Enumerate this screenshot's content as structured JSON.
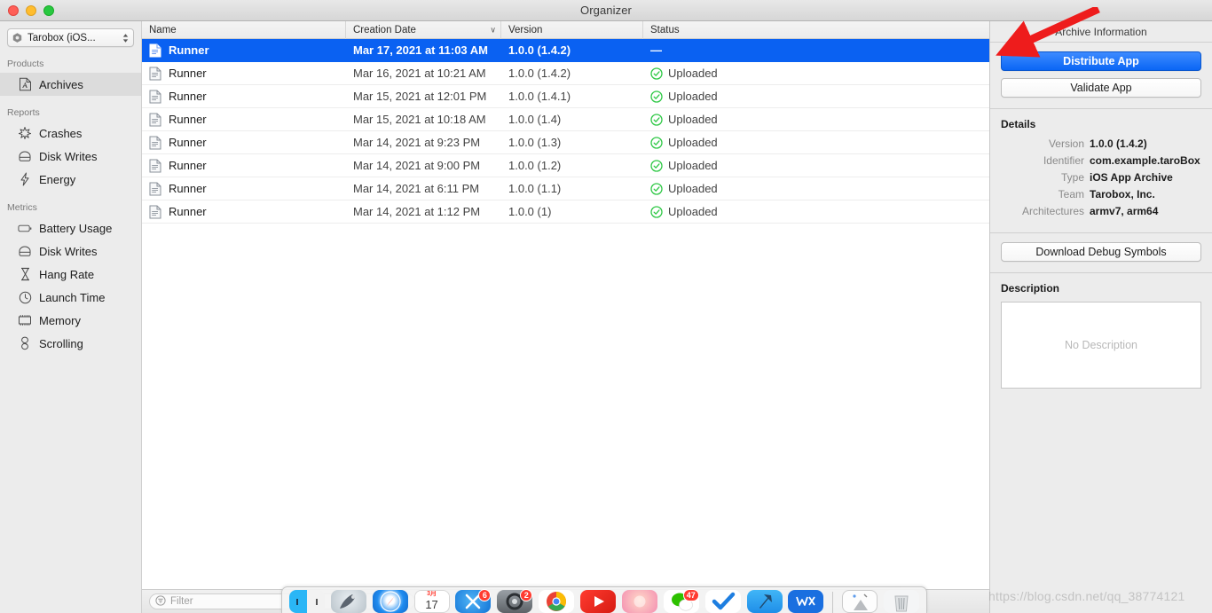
{
  "window": {
    "title": "Organizer",
    "traffic_lights": [
      "close-button",
      "minimize-button",
      "zoom-button"
    ]
  },
  "sidebar": {
    "scheme": {
      "label": "Tarobox (iOS...",
      "icon": "project-icon"
    },
    "groups": [
      {
        "title": "Products",
        "items": [
          {
            "label": "Archives",
            "icon": "archive-icon",
            "selected": true
          }
        ]
      },
      {
        "title": "Reports",
        "items": [
          {
            "label": "Crashes",
            "icon": "crashes-icon",
            "selected": false
          },
          {
            "label": "Disk Writes",
            "icon": "disk-writes-icon",
            "selected": false
          },
          {
            "label": "Energy",
            "icon": "energy-icon",
            "selected": false
          }
        ]
      },
      {
        "title": "Metrics",
        "items": [
          {
            "label": "Battery Usage",
            "icon": "battery-icon",
            "selected": false
          },
          {
            "label": "Disk Writes",
            "icon": "disk-writes-icon",
            "selected": false
          },
          {
            "label": "Hang Rate",
            "icon": "hourglass-icon",
            "selected": false
          },
          {
            "label": "Launch Time",
            "icon": "clock-icon",
            "selected": false
          },
          {
            "label": "Memory",
            "icon": "memory-icon",
            "selected": false
          },
          {
            "label": "Scrolling",
            "icon": "scrolling-icon",
            "selected": false
          }
        ]
      }
    ]
  },
  "table": {
    "columns": [
      {
        "label": "Name",
        "sorted": false
      },
      {
        "label": "Creation Date",
        "sorted": true,
        "sort_indicator": "∨"
      },
      {
        "label": "Version",
        "sorted": false
      },
      {
        "label": "Status",
        "sorted": false
      }
    ],
    "rows": [
      {
        "name": "Runner",
        "date": "Mar 17, 2021 at 11:03 AM",
        "version": "1.0.0 (1.4.2)",
        "status": "—",
        "status_icon": "none",
        "selected": true
      },
      {
        "name": "Runner",
        "date": "Mar 16, 2021 at 10:21 AM",
        "version": "1.0.0 (1.4.2)",
        "status": "Uploaded",
        "status_icon": "check-circle-icon",
        "selected": false
      },
      {
        "name": "Runner",
        "date": "Mar 15, 2021 at 12:01 PM",
        "version": "1.0.0 (1.4.1)",
        "status": "Uploaded",
        "status_icon": "check-circle-icon",
        "selected": false
      },
      {
        "name": "Runner",
        "date": "Mar 15, 2021 at 10:18 AM",
        "version": "1.0.0 (1.4)",
        "status": "Uploaded",
        "status_icon": "check-circle-icon",
        "selected": false
      },
      {
        "name": "Runner",
        "date": "Mar 14, 2021 at 9:23 PM",
        "version": "1.0.0 (1.3)",
        "status": "Uploaded",
        "status_icon": "check-circle-icon",
        "selected": false
      },
      {
        "name": "Runner",
        "date": "Mar 14, 2021 at 9:00 PM",
        "version": "1.0.0 (1.2)",
        "status": "Uploaded",
        "status_icon": "check-circle-icon",
        "selected": false
      },
      {
        "name": "Runner",
        "date": "Mar 14, 2021 at 6:11 PM",
        "version": "1.0.0 (1.1)",
        "status": "Uploaded",
        "status_icon": "check-circle-icon",
        "selected": false
      },
      {
        "name": "Runner",
        "date": "Mar 14, 2021 at 1:12 PM",
        "version": "1.0.0 (1)",
        "status": "Uploaded",
        "status_icon": "check-circle-icon",
        "selected": false
      }
    ]
  },
  "filter": {
    "placeholder": "Filter",
    "value": "",
    "icon": "filter-icon"
  },
  "inspector": {
    "title": "Archive Information",
    "distribute_label": "Distribute App",
    "validate_label": "Validate App",
    "details_heading": "Details",
    "details": [
      {
        "label": "Version",
        "value": "1.0.0 (1.4.2)"
      },
      {
        "label": "Identifier",
        "value": "com.example.taroBox"
      },
      {
        "label": "Type",
        "value": "iOS App Archive"
      },
      {
        "label": "Team",
        "value": "Tarobox, Inc."
      },
      {
        "label": "Architectures",
        "value": "armv7, arm64"
      }
    ],
    "download_label": "Download Debug Symbols",
    "description_heading": "Description",
    "description_placeholder": "No Description"
  },
  "dock": {
    "items": [
      {
        "name": "finder",
        "badge": ""
      },
      {
        "name": "launchpad",
        "badge": ""
      },
      {
        "name": "safari",
        "badge": ""
      },
      {
        "name": "calendar",
        "badge": "",
        "month": "3月",
        "day": "17"
      },
      {
        "name": "xcode",
        "badge": "6"
      },
      {
        "name": "system-preferences",
        "badge": "2"
      },
      {
        "name": "chrome",
        "badge": ""
      },
      {
        "name": "video-player",
        "badge": ""
      },
      {
        "name": "photos",
        "badge": ""
      },
      {
        "name": "wechat",
        "badge": "47"
      },
      {
        "name": "things",
        "badge": ""
      },
      {
        "name": "xcode-beta",
        "badge": ""
      },
      {
        "name": "wps",
        "badge": ""
      },
      {
        "name": "downloads-stack",
        "badge": ""
      },
      {
        "name": "trash",
        "badge": ""
      }
    ]
  },
  "annotation": {
    "arrow": "red-arrow-pointing-to-distribute-app",
    "color": "#ee1c1c"
  },
  "watermark": {
    "text": "https://blog.csdn.net/qq_38774121"
  },
  "colors": {
    "selection_blue": "#0a61f2",
    "status_green": "#2ec845",
    "accent_red": "#ee1c1c"
  }
}
